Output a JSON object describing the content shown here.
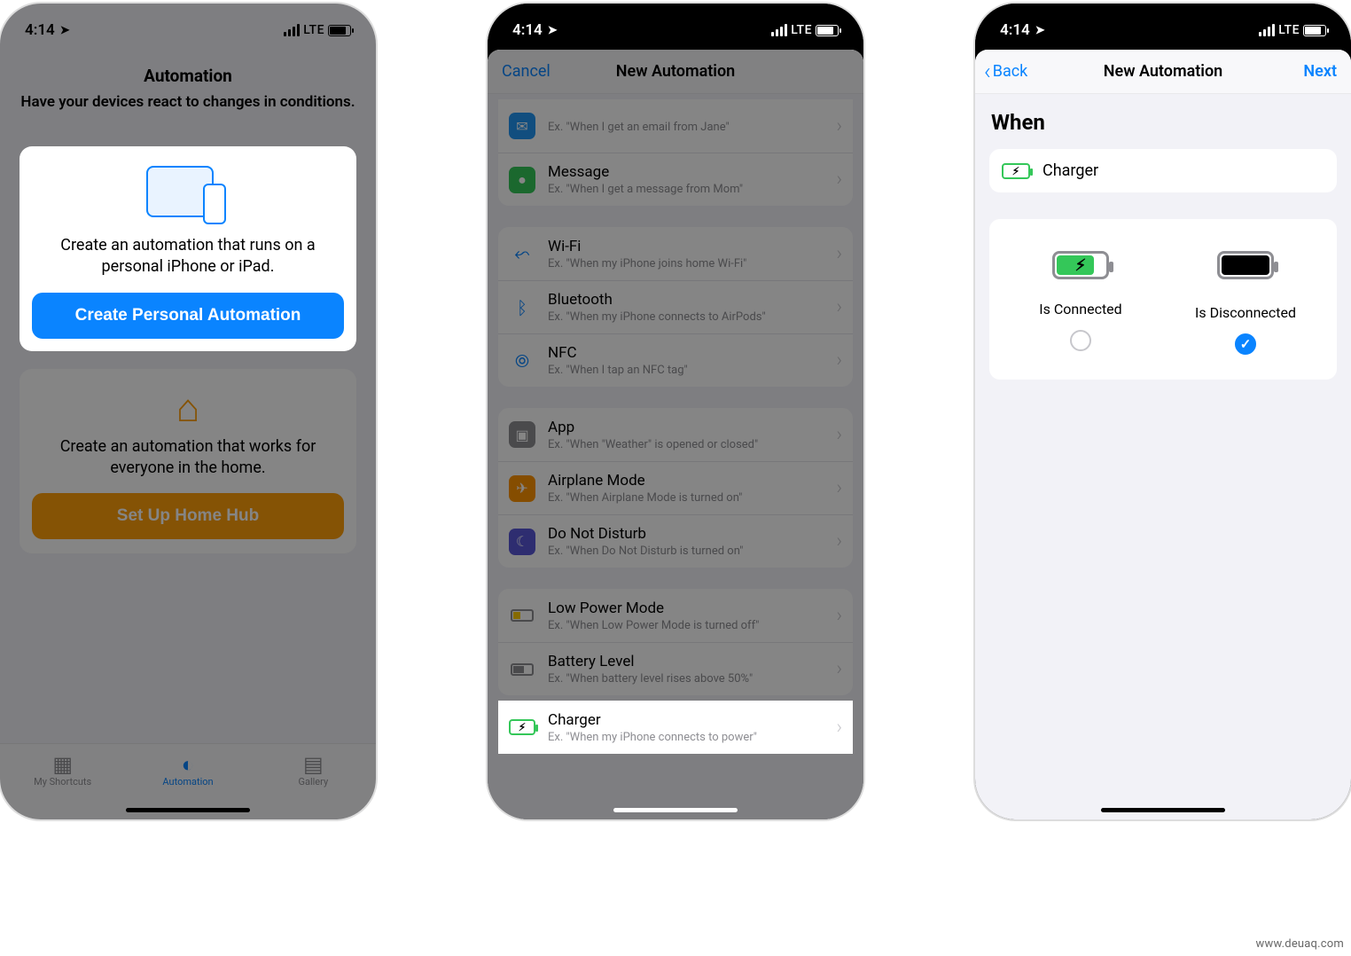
{
  "status": {
    "time": "4:14",
    "net": "LTE"
  },
  "phone1": {
    "title": "Automation",
    "subtitle": "Have your devices react to changes in conditions.",
    "card_text": "Create an automation that runs on a personal iPhone or iPad.",
    "card_btn": "Create Personal Automation",
    "home_text": "Create an automation that works for everyone in the home.",
    "home_btn": "Set Up Home Hub",
    "tabs": {
      "shortcuts": "My Shortcuts",
      "automation": "Automation",
      "gallery": "Gallery"
    }
  },
  "phone2": {
    "cancel": "Cancel",
    "title": "New Automation",
    "rows": {
      "email_sub": "Ex. \"When I get an email from Jane\"",
      "message": "Message",
      "message_sub": "Ex. \"When I get a message from Mom\"",
      "wifi": "Wi-Fi",
      "wifi_sub": "Ex. \"When my iPhone joins home Wi-Fi\"",
      "bt": "Bluetooth",
      "bt_sub": "Ex. \"When my iPhone connects to AirPods\"",
      "nfc": "NFC",
      "nfc_sub": "Ex. \"When I tap an NFC tag\"",
      "app": "App",
      "app_sub": "Ex. \"When \"Weather\" is opened or closed\"",
      "airplane": "Airplane Mode",
      "airplane_sub": "Ex. \"When Airplane Mode is turned on\"",
      "dnd": "Do Not Disturb",
      "dnd_sub": "Ex. \"When Do Not Disturb is turned on\"",
      "lpm": "Low Power Mode",
      "lpm_sub": "Ex. \"When Low Power Mode is turned off\"",
      "battery": "Battery Level",
      "battery_sub": "Ex. \"When battery level rises above 50%\"",
      "charger": "Charger",
      "charger_sub": "Ex. \"When my iPhone connects to power\""
    }
  },
  "phone3": {
    "back": "Back",
    "title": "New Automation",
    "next": "Next",
    "when": "When",
    "charger": "Charger",
    "connected": "Is Connected",
    "disconnected": "Is Disconnected"
  },
  "watermark": "www.deuaq.com"
}
